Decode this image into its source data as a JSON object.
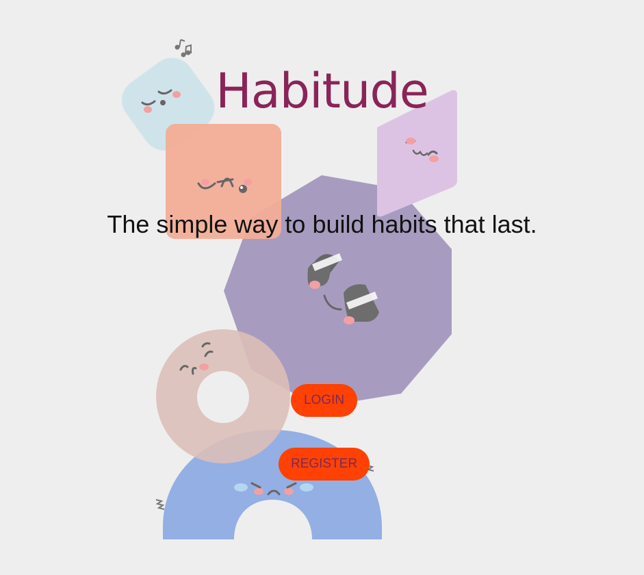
{
  "app": {
    "title": "Habitude",
    "tagline": "The simple way to build habits that last."
  },
  "buttons": {
    "login_label": "LOGIN",
    "register_label": "REGISTER"
  },
  "colors": {
    "background": "#eeeeef",
    "title": "#8a2458",
    "button": "#ff4104",
    "button_text": "#7a2a57"
  },
  "icons": [
    "music-notes-icon",
    "blue-square-character",
    "orange-square-character",
    "purple-rhombus-character",
    "lilac-nonagon-character",
    "pink-donut-character",
    "blue-arch-character"
  ]
}
